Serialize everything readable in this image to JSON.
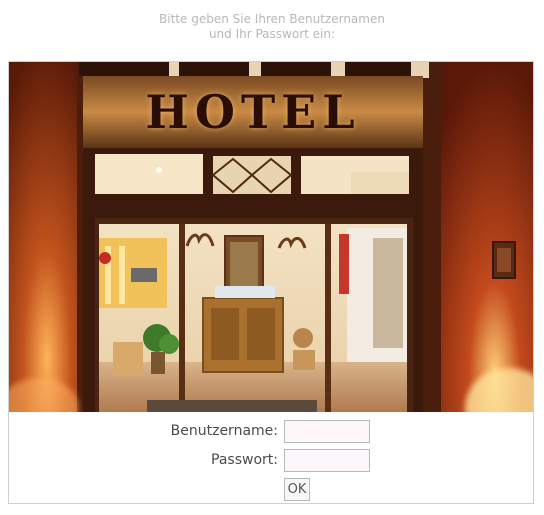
{
  "instructions": {
    "line1": "Bitte geben Sie Ihren Benutzernamen",
    "line2": "und Ihr Passwort ein:"
  },
  "image": {
    "sign_text": "HOTEL"
  },
  "form": {
    "username_label": "Benutzername:",
    "username_value": "",
    "password_label": "Passwort:",
    "password_value": "",
    "submit_label": "OK"
  },
  "colors": {
    "instruction_text": "#b8b8b8",
    "label_text": "#4a4a4a",
    "input_background": "#fbf7fa",
    "border": "#b9b9b9"
  }
}
